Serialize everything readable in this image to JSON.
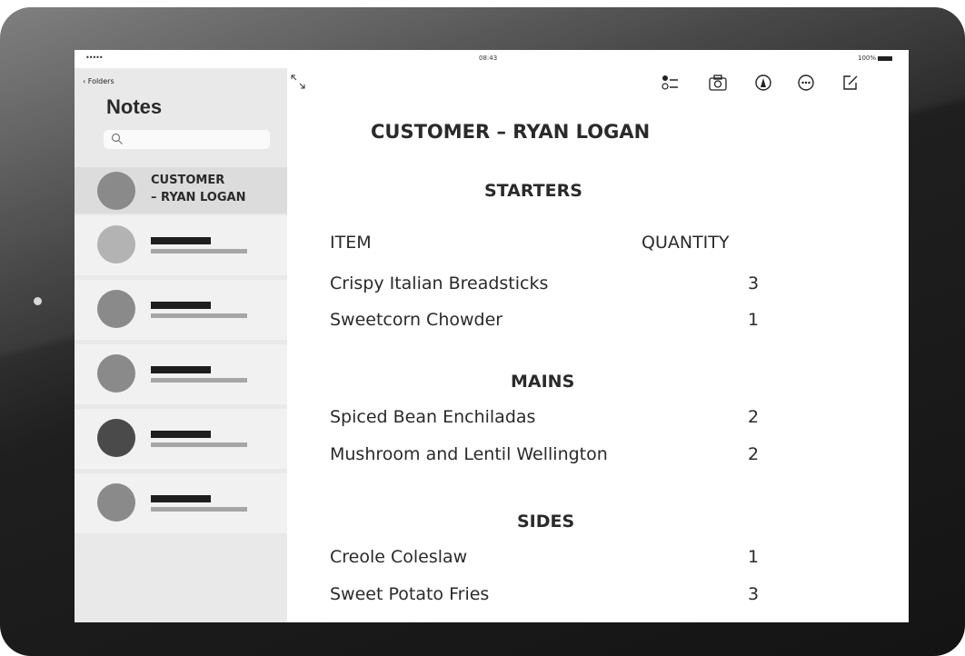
{
  "status_bar": {
    "signal": "•••••",
    "time": "08:43",
    "battery": "100%"
  },
  "sidebar": {
    "folders_link": "Folders",
    "title": "Notes",
    "search_placeholder": "",
    "active_note": {
      "title_line1": "CUSTOMER",
      "title_line2": "– RYAN LOGAN"
    },
    "avatar_colors": [
      "#8a8a8a",
      "#b3b3b3",
      "#8a8a8a",
      "#8a8a8a",
      "#4a4a4a",
      "#8a8a8a"
    ]
  },
  "toolbar": {
    "icons": [
      "expand-icon",
      "checklist-icon",
      "camera-icon",
      "markup-icon",
      "more-icon",
      "compose-icon"
    ]
  },
  "document": {
    "title": "CUSTOMER – RYAN LOGAN",
    "starters_heading": "STARTERS",
    "column_item": "ITEM",
    "column_quantity": "QUANTITY",
    "starters": [
      {
        "item": "Crispy Italian Breadsticks",
        "quantity": "3"
      },
      {
        "item": "Sweetcorn Chowder",
        "quantity": "1"
      }
    ],
    "mains_heading": "MAINS",
    "mains": [
      {
        "item": "Spiced Bean Enchiladas",
        "quantity": "2"
      },
      {
        "item": "Mushroom and Lentil Wellington",
        "quantity": "2"
      }
    ],
    "sides_heading": "SIDES",
    "sides": [
      {
        "item": "Creole Coleslaw",
        "quantity": "1"
      },
      {
        "item": "Sweet Potato Fries",
        "quantity": "3"
      }
    ]
  }
}
